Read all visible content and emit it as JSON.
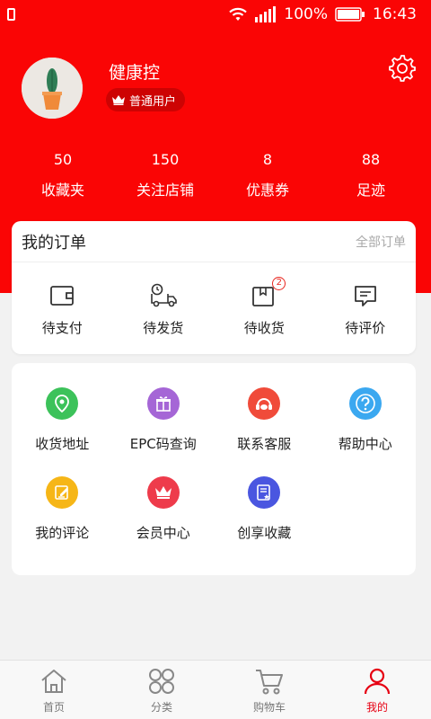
{
  "status_bar": {
    "battery": "100%",
    "time": "16:43"
  },
  "profile": {
    "username": "健康控",
    "member_level": "普通用户"
  },
  "stats": [
    {
      "value": "50",
      "label": "收藏夹"
    },
    {
      "value": "150",
      "label": "关注店铺"
    },
    {
      "value": "8",
      "label": "优惠券"
    },
    {
      "value": "88",
      "label": "足迹"
    }
  ],
  "orders": {
    "title": "我的订单",
    "all_label": "全部订单",
    "items": [
      {
        "label": "待支付",
        "icon": "wallet-icon"
      },
      {
        "label": "待发货",
        "icon": "truck-icon"
      },
      {
        "label": "待收货",
        "icon": "box-icon",
        "badge": "2"
      },
      {
        "label": "待评价",
        "icon": "comment-icon"
      }
    ]
  },
  "services": [
    {
      "label": "收货地址",
      "icon": "location-icon",
      "color": "#3cc25a"
    },
    {
      "label": "EPC码查询",
      "icon": "gift-icon",
      "color": "#a566d6"
    },
    {
      "label": "联系客服",
      "icon": "headset-icon",
      "color": "#f04b3a"
    },
    {
      "label": "帮助中心",
      "icon": "help-icon",
      "color": "#3ba8f0"
    },
    {
      "label": "我的评论",
      "icon": "edit-icon",
      "color": "#f6b617"
    },
    {
      "label": "会员中心",
      "icon": "crown-icon",
      "color": "#ee3b4b"
    },
    {
      "label": "创享收藏",
      "icon": "favorite-doc-icon",
      "color": "#4a56e0"
    }
  ],
  "tabbar": [
    {
      "label": "首页",
      "icon": "home-icon"
    },
    {
      "label": "分类",
      "icon": "category-icon"
    },
    {
      "label": "购物车",
      "icon": "cart-icon"
    },
    {
      "label": "我的",
      "icon": "user-icon",
      "active": true
    }
  ],
  "colors": {
    "brand_red": "#fa0505",
    "active_tab": "#e60012"
  }
}
